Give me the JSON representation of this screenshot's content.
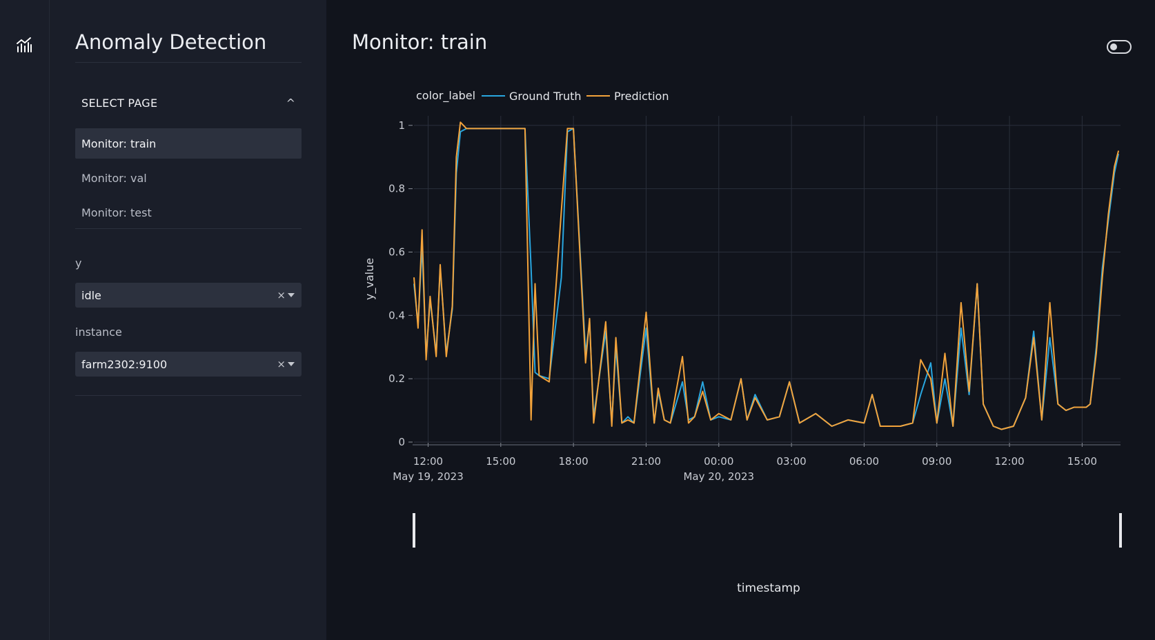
{
  "sidebar": {
    "app_icon": "chart-line-icon",
    "app_title": "Anomaly Detection",
    "section_label": "SELECT PAGE",
    "section_chevron": "^",
    "pages": [
      {
        "label": "Monitor: train",
        "active": true
      },
      {
        "label": "Monitor: val",
        "active": false
      },
      {
        "label": "Monitor: test",
        "active": false
      }
    ],
    "filters": {
      "y_label": "y",
      "y_value": "idle",
      "instance_label": "instance",
      "instance_value": "farm2302:9100",
      "clear_glyph": "×"
    }
  },
  "main": {
    "title": "Monitor: train",
    "theme_toggle_on": false
  },
  "colors": {
    "ground_truth": "#29a7e0",
    "prediction": "#f3a33b",
    "background": "#11141c",
    "sidebar": "#1a1e29"
  },
  "chart_data": {
    "type": "line",
    "legend_title": "color_label",
    "legend_placement": "top-left",
    "xlabel": "timestamp",
    "ylabel": "y_value",
    "xlim": [
      "2023-05-19T11:25",
      "2023-05-20T16:35"
    ],
    "ylim": [
      0,
      1.03
    ],
    "yticks": [
      0,
      0.2,
      0.4,
      0.6,
      0.8,
      1
    ],
    "ytick_labels": [
      "0",
      "0.2",
      "0.4",
      "0.6",
      "0.8",
      "1"
    ],
    "xticks": [
      {
        "t": "2023-05-19T12:00",
        "label": "12:00",
        "sublabel": "May 19, 2023"
      },
      {
        "t": "2023-05-19T15:00",
        "label": "15:00",
        "sublabel": ""
      },
      {
        "t": "2023-05-19T18:00",
        "label": "18:00",
        "sublabel": ""
      },
      {
        "t": "2023-05-19T21:00",
        "label": "21:00",
        "sublabel": ""
      },
      {
        "t": "2023-05-20T00:00",
        "label": "00:00",
        "sublabel": "May 20, 2023"
      },
      {
        "t": "2023-05-20T03:00",
        "label": "03:00",
        "sublabel": ""
      },
      {
        "t": "2023-05-20T06:00",
        "label": "06:00",
        "sublabel": ""
      },
      {
        "t": "2023-05-20T09:00",
        "label": "09:00",
        "sublabel": ""
      },
      {
        "t": "2023-05-20T12:00",
        "label": "12:00",
        "sublabel": ""
      },
      {
        "t": "2023-05-20T15:00",
        "label": "15:00",
        "sublabel": ""
      }
    ],
    "grid": true,
    "range_slider": true,
    "series": [
      {
        "name": "Ground Truth",
        "x": [
          "2023-05-19T11:25",
          "2023-05-19T11:35",
          "2023-05-19T11:45",
          "2023-05-19T11:55",
          "2023-05-19T12:05",
          "2023-05-19T12:20",
          "2023-05-19T12:30",
          "2023-05-19T12:45",
          "2023-05-19T13:00",
          "2023-05-19T13:10",
          "2023-05-19T13:20",
          "2023-05-19T13:35",
          "2023-05-19T14:00",
          "2023-05-19T15:00",
          "2023-05-19T16:00",
          "2023-05-19T16:15",
          "2023-05-19T16:25",
          "2023-05-19T16:35",
          "2023-05-19T17:00",
          "2023-05-19T17:30",
          "2023-05-19T17:45",
          "2023-05-19T18:00",
          "2023-05-19T18:30",
          "2023-05-19T18:40",
          "2023-05-19T18:50",
          "2023-05-19T19:20",
          "2023-05-19T19:35",
          "2023-05-19T19:45",
          "2023-05-19T20:00",
          "2023-05-19T20:15",
          "2023-05-19T20:30",
          "2023-05-19T21:00",
          "2023-05-19T21:20",
          "2023-05-19T21:30",
          "2023-05-19T21:45",
          "2023-05-19T22:00",
          "2023-05-19T22:30",
          "2023-05-19T22:45",
          "2023-05-19T23:00",
          "2023-05-19T23:20",
          "2023-05-19T23:40",
          "2023-05-20T00:00",
          "2023-05-20T00:30",
          "2023-05-20T00:55",
          "2023-05-20T01:10",
          "2023-05-20T01:30",
          "2023-05-20T02:00",
          "2023-05-20T02:30",
          "2023-05-20T02:55",
          "2023-05-20T03:20",
          "2023-05-20T04:00",
          "2023-05-20T04:40",
          "2023-05-20T05:20",
          "2023-05-20T06:00",
          "2023-05-20T06:20",
          "2023-05-20T06:40",
          "2023-05-20T07:30",
          "2023-05-20T08:00",
          "2023-05-20T08:20",
          "2023-05-20T08:45",
          "2023-05-20T09:00",
          "2023-05-20T09:20",
          "2023-05-20T09:40",
          "2023-05-20T10:00",
          "2023-05-20T10:20",
          "2023-05-20T10:40",
          "2023-05-20T10:55",
          "2023-05-20T11:20",
          "2023-05-20T11:40",
          "2023-05-20T12:10",
          "2023-05-20T12:40",
          "2023-05-20T13:00",
          "2023-05-20T13:20",
          "2023-05-20T13:40",
          "2023-05-20T14:00",
          "2023-05-20T14:20",
          "2023-05-20T14:40",
          "2023-05-20T15:10",
          "2023-05-20T15:20",
          "2023-05-20T15:35",
          "2023-05-20T15:50",
          "2023-05-20T16:05",
          "2023-05-20T16:20",
          "2023-05-20T16:30"
        ],
        "y": [
          0.5,
          0.37,
          0.62,
          0.27,
          0.45,
          0.28,
          0.55,
          0.28,
          0.42,
          0.85,
          0.98,
          0.99,
          0.99,
          0.99,
          0.99,
          0.55,
          0.22,
          0.21,
          0.2,
          0.52,
          0.98,
          0.99,
          0.28,
          0.38,
          0.08,
          0.35,
          0.06,
          0.3,
          0.06,
          0.08,
          0.06,
          0.36,
          0.06,
          0.16,
          0.07,
          0.06,
          0.19,
          0.07,
          0.08,
          0.19,
          0.07,
          0.08,
          0.07,
          0.2,
          0.07,
          0.15,
          0.07,
          0.08,
          0.19,
          0.06,
          0.09,
          0.05,
          0.07,
          0.06,
          0.15,
          0.05,
          0.05,
          0.06,
          0.15,
          0.25,
          0.06,
          0.2,
          0.05,
          0.36,
          0.15,
          0.5,
          0.12,
          0.05,
          0.04,
          0.05,
          0.14,
          0.35,
          0.07,
          0.33,
          0.12,
          0.1,
          0.11,
          0.11,
          0.12,
          0.3,
          0.55,
          0.7,
          0.85,
          0.91
        ]
      },
      {
        "name": "Prediction",
        "x": [
          "2023-05-19T11:25",
          "2023-05-19T11:35",
          "2023-05-19T11:45",
          "2023-05-19T11:55",
          "2023-05-19T12:05",
          "2023-05-19T12:20",
          "2023-05-19T12:30",
          "2023-05-19T12:45",
          "2023-05-19T13:00",
          "2023-05-19T13:10",
          "2023-05-19T13:20",
          "2023-05-19T13:35",
          "2023-05-19T14:00",
          "2023-05-19T15:00",
          "2023-05-19T16:00",
          "2023-05-19T16:15",
          "2023-05-19T16:25",
          "2023-05-19T16:35",
          "2023-05-19T17:00",
          "2023-05-19T17:30",
          "2023-05-19T17:45",
          "2023-05-19T18:00",
          "2023-05-19T18:30",
          "2023-05-19T18:40",
          "2023-05-19T18:50",
          "2023-05-19T19:20",
          "2023-05-19T19:35",
          "2023-05-19T19:45",
          "2023-05-19T20:00",
          "2023-05-19T20:15",
          "2023-05-19T20:30",
          "2023-05-19T21:00",
          "2023-05-19T21:20",
          "2023-05-19T21:30",
          "2023-05-19T21:45",
          "2023-05-19T22:00",
          "2023-05-19T22:30",
          "2023-05-19T22:45",
          "2023-05-19T23:00",
          "2023-05-19T23:20",
          "2023-05-19T23:40",
          "2023-05-20T00:00",
          "2023-05-20T00:30",
          "2023-05-20T00:55",
          "2023-05-20T01:10",
          "2023-05-20T01:30",
          "2023-05-20T02:00",
          "2023-05-20T02:30",
          "2023-05-20T02:55",
          "2023-05-20T03:20",
          "2023-05-20T04:00",
          "2023-05-20T04:40",
          "2023-05-20T05:20",
          "2023-05-20T06:00",
          "2023-05-20T06:20",
          "2023-05-20T06:40",
          "2023-05-20T07:30",
          "2023-05-20T08:00",
          "2023-05-20T08:20",
          "2023-05-20T08:45",
          "2023-05-20T09:00",
          "2023-05-20T09:20",
          "2023-05-20T09:40",
          "2023-05-20T10:00",
          "2023-05-20T10:20",
          "2023-05-20T10:40",
          "2023-05-20T10:55",
          "2023-05-20T11:20",
          "2023-05-20T11:40",
          "2023-05-20T12:10",
          "2023-05-20T12:40",
          "2023-05-20T13:00",
          "2023-05-20T13:20",
          "2023-05-20T13:40",
          "2023-05-20T14:00",
          "2023-05-20T14:20",
          "2023-05-20T14:40",
          "2023-05-20T15:10",
          "2023-05-20T15:20",
          "2023-05-20T15:35",
          "2023-05-20T15:50",
          "2023-05-20T16:05",
          "2023-05-20T16:20",
          "2023-05-20T16:30"
        ],
        "y": [
          0.52,
          0.36,
          0.67,
          0.26,
          0.46,
          0.27,
          0.56,
          0.27,
          0.43,
          0.9,
          1.01,
          0.99,
          0.99,
          0.99,
          0.99,
          0.07,
          0.5,
          0.21,
          0.19,
          0.73,
          0.99,
          0.99,
          0.25,
          0.39,
          0.06,
          0.38,
          0.05,
          0.33,
          0.06,
          0.07,
          0.06,
          0.41,
          0.06,
          0.17,
          0.07,
          0.06,
          0.27,
          0.06,
          0.08,
          0.16,
          0.07,
          0.09,
          0.07,
          0.2,
          0.07,
          0.14,
          0.07,
          0.08,
          0.19,
          0.06,
          0.09,
          0.05,
          0.07,
          0.06,
          0.15,
          0.05,
          0.05,
          0.06,
          0.26,
          0.2,
          0.06,
          0.28,
          0.05,
          0.44,
          0.16,
          0.5,
          0.12,
          0.05,
          0.04,
          0.05,
          0.14,
          0.33,
          0.07,
          0.44,
          0.12,
          0.1,
          0.11,
          0.11,
          0.12,
          0.28,
          0.52,
          0.72,
          0.87,
          0.92
        ]
      }
    ]
  }
}
